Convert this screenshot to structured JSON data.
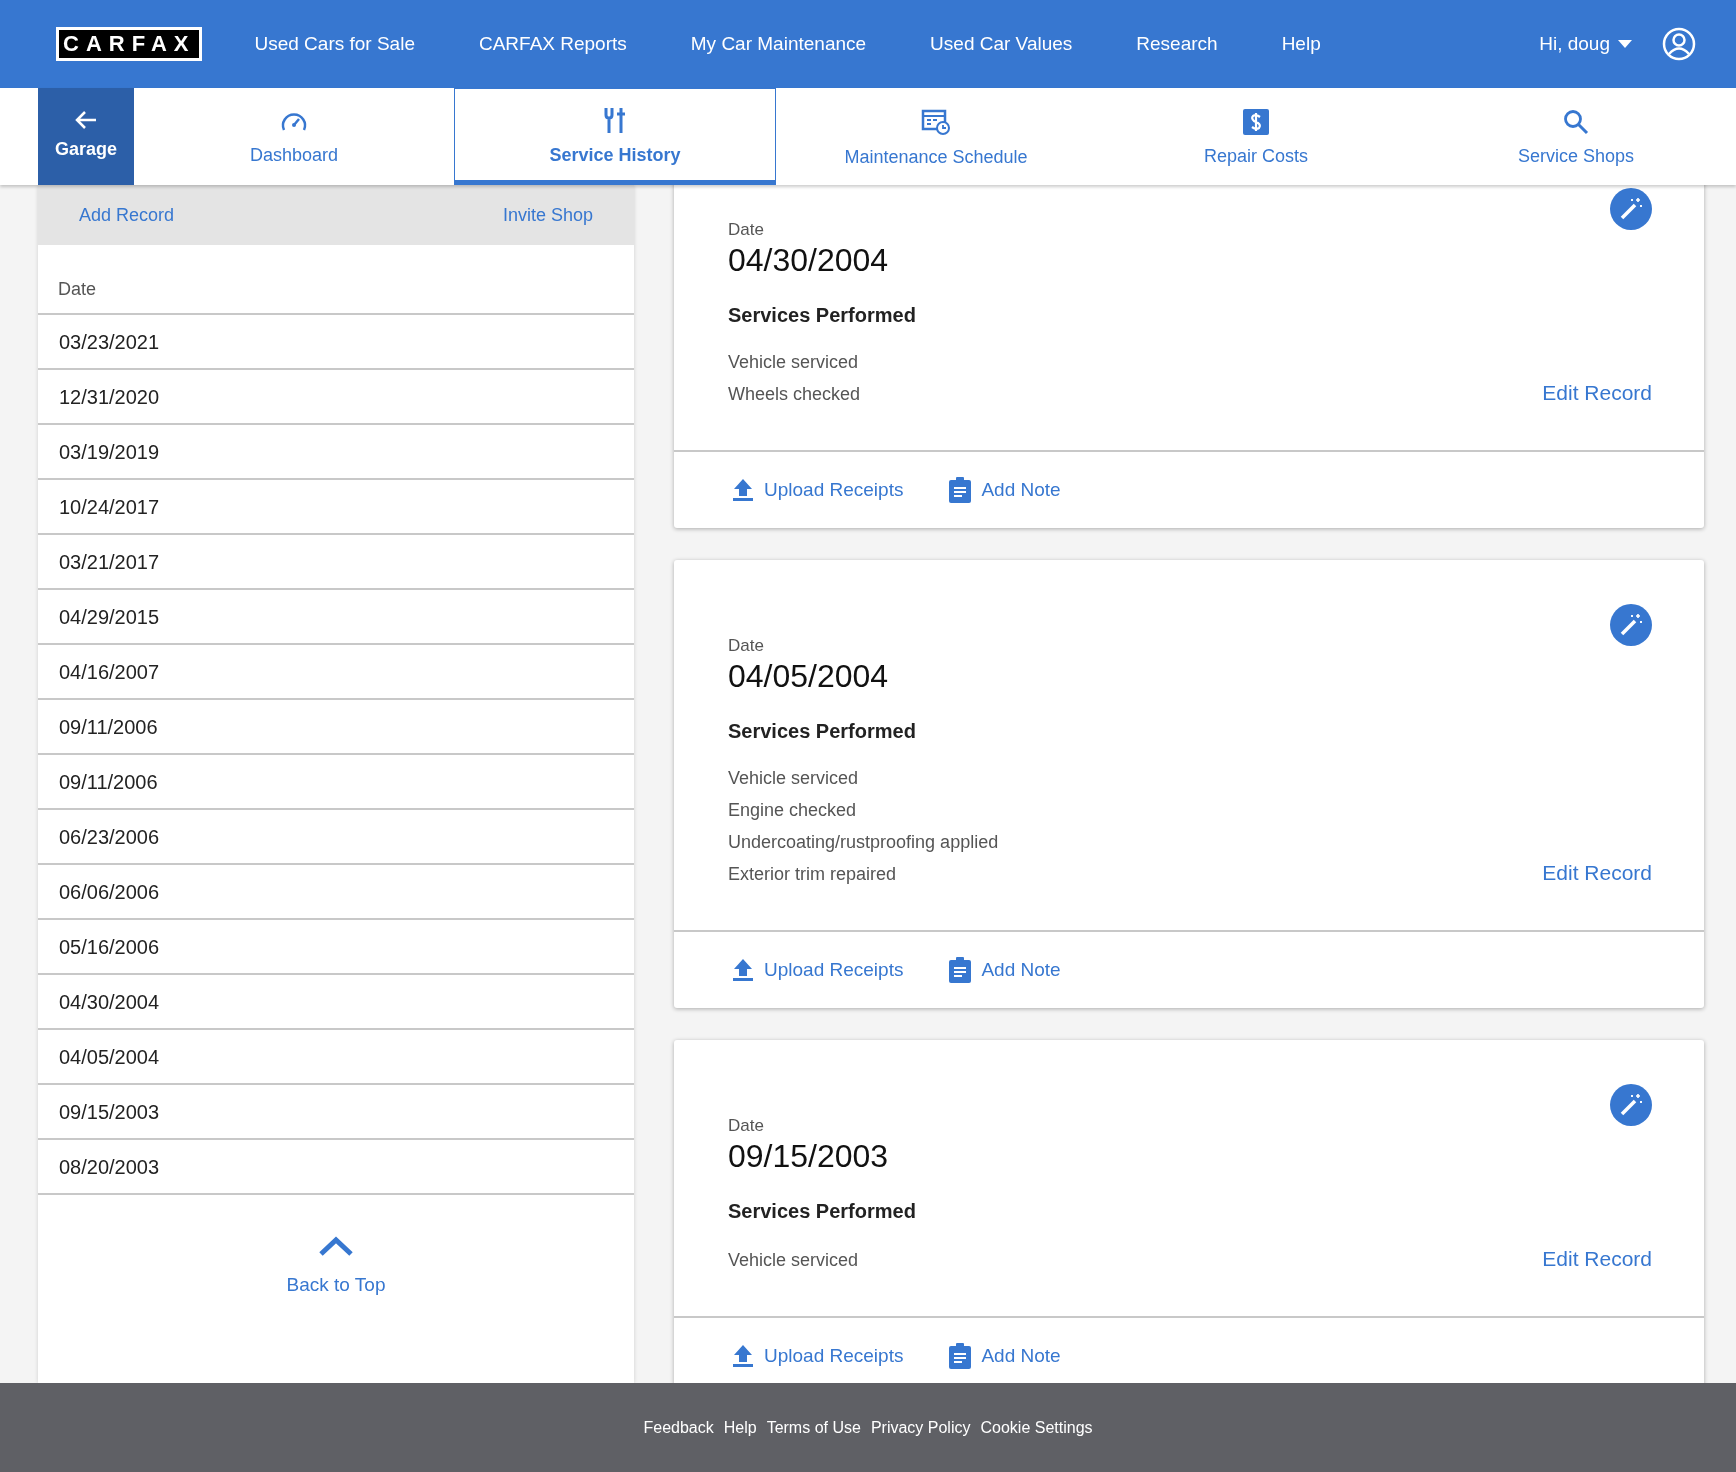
{
  "header": {
    "logo": "CARFAX",
    "nav": [
      "Used Cars for Sale",
      "CARFAX Reports",
      "My Car Maintenance",
      "Used Car Values",
      "Research",
      "Help"
    ],
    "user": "Hi, doug"
  },
  "back": {
    "label": "Garage"
  },
  "tabs": [
    {
      "label": "Dashboard",
      "kind": "gauge",
      "selected": false
    },
    {
      "label": "Service History",
      "kind": "tools",
      "selected": true
    },
    {
      "label": "Maintenance Schedule",
      "kind": "schedule",
      "selected": false
    },
    {
      "label": "Repair Costs",
      "kind": "dollar",
      "selected": false
    },
    {
      "label": "Service Shops",
      "kind": "search",
      "selected": false
    }
  ],
  "sidebar": {
    "actions": [
      "Add Record",
      "Invite Shop"
    ],
    "column": "Date",
    "dates": [
      "03/23/2021",
      "12/31/2020",
      "03/19/2019",
      "10/24/2017",
      "03/21/2017",
      "04/29/2015",
      "04/16/2007",
      "09/11/2006",
      "09/11/2006",
      "06/23/2006",
      "06/06/2006",
      "05/16/2006",
      "04/30/2004",
      "04/05/2004",
      "09/15/2003",
      "08/20/2003"
    ],
    "back_to_top": "Back to Top"
  },
  "records": [
    {
      "date_label": "Date",
      "date": "04/30/2004",
      "heading": "Services Performed",
      "services": [
        "Vehicle serviced",
        "Wheels checked"
      ],
      "edit": "Edit Record",
      "upload": "Upload Receipts",
      "note": "Add Note"
    },
    {
      "date_label": "Date",
      "date": "04/05/2004",
      "heading": "Services Performed",
      "services": [
        "Vehicle serviced",
        "Engine checked",
        "Undercoating/rustproofing applied",
        "Exterior trim repaired"
      ],
      "edit": "Edit Record",
      "upload": "Upload Receipts",
      "note": "Add Note"
    },
    {
      "date_label": "Date",
      "date": "09/15/2003",
      "heading": "Services Performed",
      "services": [
        "Vehicle serviced"
      ],
      "edit": "Edit Record",
      "upload": "Upload Receipts",
      "note": "Add Note"
    }
  ],
  "footer": [
    "Feedback",
    "Help",
    "Terms of Use",
    "Privacy Policy",
    "Cookie Settings"
  ]
}
